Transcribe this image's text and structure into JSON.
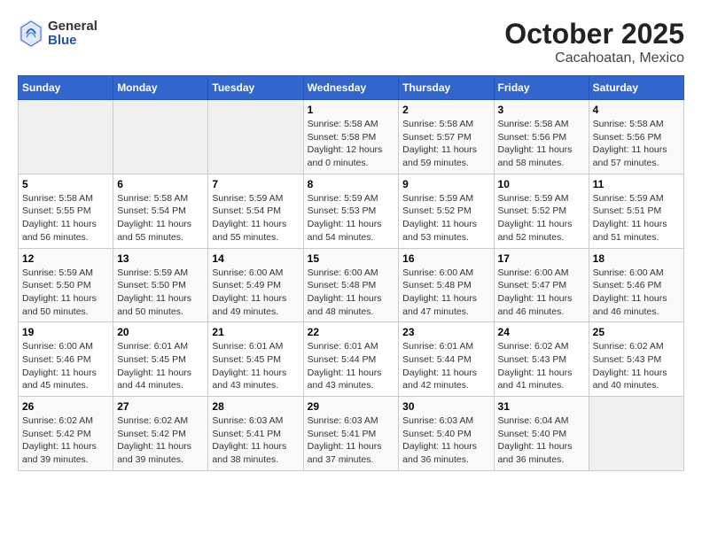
{
  "header": {
    "logo_general": "General",
    "logo_blue": "Blue",
    "title": "October 2025",
    "subtitle": "Cacahoatan, Mexico"
  },
  "calendar": {
    "days_of_week": [
      "Sunday",
      "Monday",
      "Tuesday",
      "Wednesday",
      "Thursday",
      "Friday",
      "Saturday"
    ],
    "weeks": [
      [
        {
          "day": "",
          "info": ""
        },
        {
          "day": "",
          "info": ""
        },
        {
          "day": "",
          "info": ""
        },
        {
          "day": "1",
          "info": "Sunrise: 5:58 AM\nSunset: 5:58 PM\nDaylight: 12 hours\nand 0 minutes."
        },
        {
          "day": "2",
          "info": "Sunrise: 5:58 AM\nSunset: 5:57 PM\nDaylight: 11 hours\nand 59 minutes."
        },
        {
          "day": "3",
          "info": "Sunrise: 5:58 AM\nSunset: 5:56 PM\nDaylight: 11 hours\nand 58 minutes."
        },
        {
          "day": "4",
          "info": "Sunrise: 5:58 AM\nSunset: 5:56 PM\nDaylight: 11 hours\nand 57 minutes."
        }
      ],
      [
        {
          "day": "5",
          "info": "Sunrise: 5:58 AM\nSunset: 5:55 PM\nDaylight: 11 hours\nand 56 minutes."
        },
        {
          "day": "6",
          "info": "Sunrise: 5:58 AM\nSunset: 5:54 PM\nDaylight: 11 hours\nand 55 minutes."
        },
        {
          "day": "7",
          "info": "Sunrise: 5:59 AM\nSunset: 5:54 PM\nDaylight: 11 hours\nand 55 minutes."
        },
        {
          "day": "8",
          "info": "Sunrise: 5:59 AM\nSunset: 5:53 PM\nDaylight: 11 hours\nand 54 minutes."
        },
        {
          "day": "9",
          "info": "Sunrise: 5:59 AM\nSunset: 5:52 PM\nDaylight: 11 hours\nand 53 minutes."
        },
        {
          "day": "10",
          "info": "Sunrise: 5:59 AM\nSunset: 5:52 PM\nDaylight: 11 hours\nand 52 minutes."
        },
        {
          "day": "11",
          "info": "Sunrise: 5:59 AM\nSunset: 5:51 PM\nDaylight: 11 hours\nand 51 minutes."
        }
      ],
      [
        {
          "day": "12",
          "info": "Sunrise: 5:59 AM\nSunset: 5:50 PM\nDaylight: 11 hours\nand 50 minutes."
        },
        {
          "day": "13",
          "info": "Sunrise: 5:59 AM\nSunset: 5:50 PM\nDaylight: 11 hours\nand 50 minutes."
        },
        {
          "day": "14",
          "info": "Sunrise: 6:00 AM\nSunset: 5:49 PM\nDaylight: 11 hours\nand 49 minutes."
        },
        {
          "day": "15",
          "info": "Sunrise: 6:00 AM\nSunset: 5:48 PM\nDaylight: 11 hours\nand 48 minutes."
        },
        {
          "day": "16",
          "info": "Sunrise: 6:00 AM\nSunset: 5:48 PM\nDaylight: 11 hours\nand 47 minutes."
        },
        {
          "day": "17",
          "info": "Sunrise: 6:00 AM\nSunset: 5:47 PM\nDaylight: 11 hours\nand 46 minutes."
        },
        {
          "day": "18",
          "info": "Sunrise: 6:00 AM\nSunset: 5:46 PM\nDaylight: 11 hours\nand 46 minutes."
        }
      ],
      [
        {
          "day": "19",
          "info": "Sunrise: 6:00 AM\nSunset: 5:46 PM\nDaylight: 11 hours\nand 45 minutes."
        },
        {
          "day": "20",
          "info": "Sunrise: 6:01 AM\nSunset: 5:45 PM\nDaylight: 11 hours\nand 44 minutes."
        },
        {
          "day": "21",
          "info": "Sunrise: 6:01 AM\nSunset: 5:45 PM\nDaylight: 11 hours\nand 43 minutes."
        },
        {
          "day": "22",
          "info": "Sunrise: 6:01 AM\nSunset: 5:44 PM\nDaylight: 11 hours\nand 43 minutes."
        },
        {
          "day": "23",
          "info": "Sunrise: 6:01 AM\nSunset: 5:44 PM\nDaylight: 11 hours\nand 42 minutes."
        },
        {
          "day": "24",
          "info": "Sunrise: 6:02 AM\nSunset: 5:43 PM\nDaylight: 11 hours\nand 41 minutes."
        },
        {
          "day": "25",
          "info": "Sunrise: 6:02 AM\nSunset: 5:43 PM\nDaylight: 11 hours\nand 40 minutes."
        }
      ],
      [
        {
          "day": "26",
          "info": "Sunrise: 6:02 AM\nSunset: 5:42 PM\nDaylight: 11 hours\nand 39 minutes."
        },
        {
          "day": "27",
          "info": "Sunrise: 6:02 AM\nSunset: 5:42 PM\nDaylight: 11 hours\nand 39 minutes."
        },
        {
          "day": "28",
          "info": "Sunrise: 6:03 AM\nSunset: 5:41 PM\nDaylight: 11 hours\nand 38 minutes."
        },
        {
          "day": "29",
          "info": "Sunrise: 6:03 AM\nSunset: 5:41 PM\nDaylight: 11 hours\nand 37 minutes."
        },
        {
          "day": "30",
          "info": "Sunrise: 6:03 AM\nSunset: 5:40 PM\nDaylight: 11 hours\nand 36 minutes."
        },
        {
          "day": "31",
          "info": "Sunrise: 6:04 AM\nSunset: 5:40 PM\nDaylight: 11 hours\nand 36 minutes."
        },
        {
          "day": "",
          "info": ""
        }
      ]
    ]
  }
}
